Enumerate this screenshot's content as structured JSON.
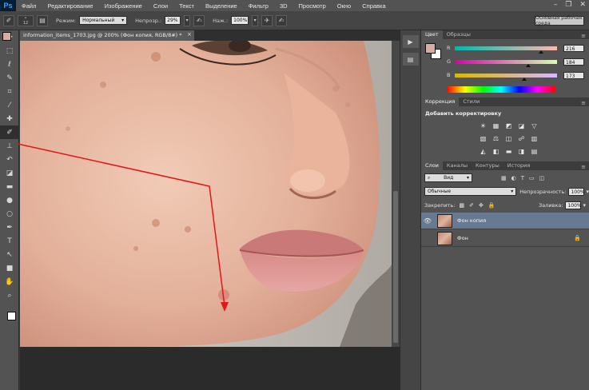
{
  "app": {
    "logo": "Ps"
  },
  "menu": [
    "Файл",
    "Редактирование",
    "Изображение",
    "Слои",
    "Текст",
    "Выделение",
    "Фильтр",
    "3D",
    "Просмотр",
    "Окно",
    "Справка"
  ],
  "window_controls": {
    "minimize": "–",
    "restore": "❐",
    "close": "✕"
  },
  "options_bar": {
    "brush_size": "12",
    "mode_label": "Режим:",
    "mode_value": "Нормальный",
    "opacity_label": "Непрозр.:",
    "opacity_value": "29%",
    "pressure_label": "Наж.:",
    "pressure_value": "100%",
    "workspace": "Основная рабочая среда"
  },
  "document": {
    "tab_title": "information_items_1703.jpg @ 200% (Фон копия, RGB/8#) *",
    "close": "×"
  },
  "tools": [
    {
      "icon": "move-icon",
      "glyph": "✥"
    },
    {
      "icon": "marquee-icon",
      "glyph": "⬚"
    },
    {
      "icon": "lasso-icon",
      "glyph": "ℓ"
    },
    {
      "icon": "quick-select-icon",
      "glyph": "✎"
    },
    {
      "icon": "crop-icon",
      "glyph": "⌗"
    },
    {
      "icon": "eyedropper-icon",
      "glyph": "⁄"
    },
    {
      "icon": "healing-brush-icon",
      "glyph": "✚"
    },
    {
      "icon": "brush-icon",
      "glyph": "✐"
    },
    {
      "icon": "clone-stamp-icon",
      "glyph": "⊥"
    },
    {
      "icon": "history-brush-icon",
      "glyph": "↶"
    },
    {
      "icon": "eraser-icon",
      "glyph": "◪"
    },
    {
      "icon": "gradient-icon",
      "glyph": "▬"
    },
    {
      "icon": "blur-icon",
      "glyph": "●"
    },
    {
      "icon": "dodge-icon",
      "glyph": "○"
    },
    {
      "icon": "pen-icon",
      "glyph": "✒"
    },
    {
      "icon": "type-icon",
      "glyph": "T"
    },
    {
      "icon": "path-select-icon",
      "glyph": "↖"
    },
    {
      "icon": "shape-icon",
      "glyph": "■"
    },
    {
      "icon": "hand-icon",
      "glyph": "✋"
    },
    {
      "icon": "zoom-icon",
      "glyph": "⌕"
    }
  ],
  "active_tool_index": 7,
  "colors": {
    "foreground": "#d8aca0",
    "background": "#ffffff",
    "accent_arrow": "#e01818"
  },
  "color_panel": {
    "tabs": [
      "Цвет",
      "Образцы"
    ],
    "R": {
      "letter": "R",
      "value": "216",
      "level": 0.847
    },
    "G": {
      "letter": "G",
      "value": "184",
      "level": 0.722
    },
    "B": {
      "letter": "B",
      "value": "173",
      "level": 0.678
    }
  },
  "adjustments_panel": {
    "tabs": [
      "Коррекция",
      "Стили"
    ],
    "title": "Добавить корректировку",
    "row1": [
      "☀",
      "▦",
      "◩",
      "◪",
      "▽"
    ],
    "row2": [
      "▧",
      "⚖",
      "◫",
      "☍",
      "▥"
    ],
    "row3": [
      "◭",
      "◧",
      "▬",
      "◨",
      "▤"
    ]
  },
  "layers_panel": {
    "tabs": [
      "Слои",
      "Каналы",
      "Контуры",
      "История"
    ],
    "filter": "Вид",
    "blend_mode": "Обычные",
    "opacity_label": "Непрозрачность:",
    "opacity_value": "100%",
    "lock_label": "Закрепить:",
    "fill_label": "Заливка:",
    "fill_value": "100%",
    "layers": [
      {
        "name": "Фон копия",
        "visible": true,
        "selected": true,
        "locked": false
      },
      {
        "name": "Фон",
        "visible": false,
        "selected": false,
        "locked": true
      }
    ]
  }
}
